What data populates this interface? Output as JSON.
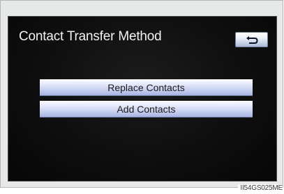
{
  "screen": {
    "title": "Contact Transfer Method",
    "back_icon": "back-arrow-icon",
    "options": [
      {
        "label": "Replace Contacts"
      },
      {
        "label": "Add Contacts"
      }
    ]
  },
  "image_code": "II54GS025ME",
  "colors": {
    "screen_background": "#0e0e0e",
    "button_light": "#f8f9ff",
    "button_dark": "#a7b3e3",
    "title_text": "#f2f2f2",
    "frame": "#e7e8e8"
  }
}
